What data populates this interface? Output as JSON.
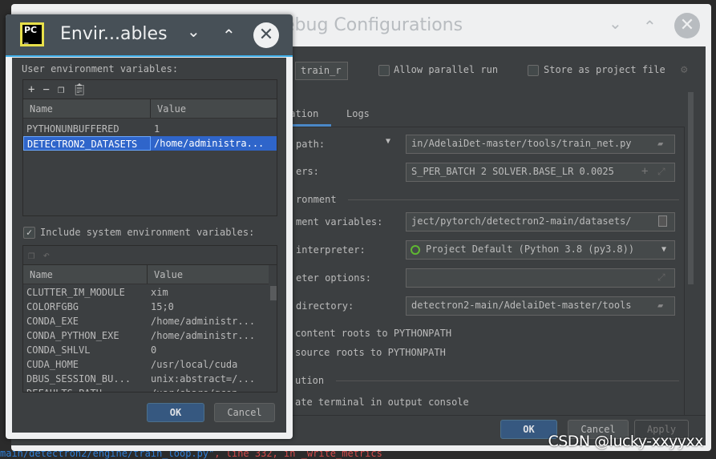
{
  "background_editor": {
    "bottom_line_path": "main/detectron2/engine/train_loop.py\"",
    "bottom_line_rest": ", line 332, in _write_metrics"
  },
  "run_config_window": {
    "title": "ebug Configurations",
    "name_field": "train_r",
    "allow_parallel_run": {
      "label": "Allow parallel run",
      "checked": false
    },
    "store_as_project_file": {
      "label": "Store as project file",
      "checked": false
    },
    "tabs": [
      {
        "label": "ration",
        "active": true
      },
      {
        "label": "Logs",
        "active": false
      }
    ],
    "rows": {
      "script_path": {
        "label": "path:",
        "value": "in/AdelaiDet-master/tools/train_net.py"
      },
      "parameters": {
        "label": "ers:",
        "value": "S_PER_BATCH 2 SOLVER.BASE_LR 0.0025"
      },
      "environment_section": "ronment",
      "env_vars": {
        "label": "ment variables:",
        "value": "ject/pytorch/detectron2-main/datasets/"
      },
      "interpreter": {
        "label": "interpreter:",
        "value": "Project Default (Python 3.8 (py3.8))"
      },
      "interpreter_options": {
        "label": "eter options:",
        "value": ""
      },
      "working_dir": {
        "label": " directory:",
        "value": "detectron2-main/AdelaiDet-master/tools"
      },
      "content_roots": "content roots to PYTHONPATH",
      "source_roots": "source roots to PYTHONPATH",
      "execution_section": "ution",
      "emulate_terminal": "ate terminal in output console"
    },
    "buttons": {
      "ok": "OK",
      "cancel": "Cancel",
      "apply": "Apply"
    }
  },
  "env_dialog": {
    "title": "Envir...ables",
    "logo_text": "PC",
    "user_label": "User environment variables:",
    "columns": {
      "name": "Name",
      "value": "Value"
    },
    "user_vars": [
      {
        "name": "PYTHONUNBUFFERED",
        "value": "1"
      },
      {
        "name": "DETECTRON2_DATASETS",
        "value": "/home/administra..."
      }
    ],
    "include_system": {
      "label": "Include system environment variables:",
      "checked": true
    },
    "system_vars": [
      {
        "name": "CLUTTER_IM_MODULE",
        "value": "xim"
      },
      {
        "name": "COLORFGBG",
        "value": "15;0"
      },
      {
        "name": "CONDA_EXE",
        "value": "/home/administr..."
      },
      {
        "name": "CONDA_PYTHON_EXE",
        "value": "/home/administr..."
      },
      {
        "name": "CONDA_SHLVL",
        "value": "0"
      },
      {
        "name": "CUDA_HOME",
        "value": "/usr/local/cuda"
      },
      {
        "name": "DBUS_SESSION_BU...",
        "value": "unix:abstract=/..."
      },
      {
        "name": "DEFAULTS_PATH",
        "value": "/usr/share/gcon..."
      }
    ],
    "buttons": {
      "ok": "OK",
      "cancel": "Cancel"
    }
  },
  "watermark": "CSDN @lucky-xxyyxx",
  "colors": {
    "accent": "#3daee9",
    "selection": "#2f65ca",
    "primary_button": "#365880",
    "panel": "#3c3f41"
  }
}
